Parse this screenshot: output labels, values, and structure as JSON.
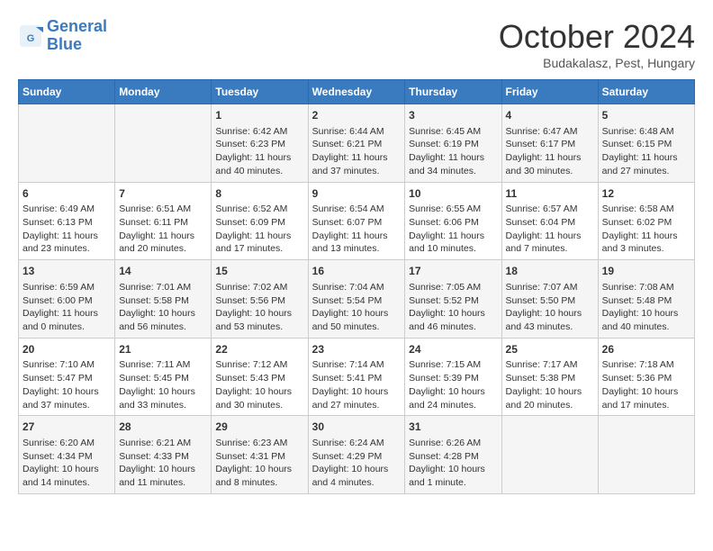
{
  "logo": {
    "line1": "General",
    "line2": "Blue"
  },
  "title": "October 2024",
  "location": "Budakalasz, Pest, Hungary",
  "days_of_week": [
    "Sunday",
    "Monday",
    "Tuesday",
    "Wednesday",
    "Thursday",
    "Friday",
    "Saturday"
  ],
  "weeks": [
    [
      {
        "day": "",
        "info": ""
      },
      {
        "day": "",
        "info": ""
      },
      {
        "day": "1",
        "info": "Sunrise: 6:42 AM\nSunset: 6:23 PM\nDaylight: 11 hours and 40 minutes."
      },
      {
        "day": "2",
        "info": "Sunrise: 6:44 AM\nSunset: 6:21 PM\nDaylight: 11 hours and 37 minutes."
      },
      {
        "day": "3",
        "info": "Sunrise: 6:45 AM\nSunset: 6:19 PM\nDaylight: 11 hours and 34 minutes."
      },
      {
        "day": "4",
        "info": "Sunrise: 6:47 AM\nSunset: 6:17 PM\nDaylight: 11 hours and 30 minutes."
      },
      {
        "day": "5",
        "info": "Sunrise: 6:48 AM\nSunset: 6:15 PM\nDaylight: 11 hours and 27 minutes."
      }
    ],
    [
      {
        "day": "6",
        "info": "Sunrise: 6:49 AM\nSunset: 6:13 PM\nDaylight: 11 hours and 23 minutes."
      },
      {
        "day": "7",
        "info": "Sunrise: 6:51 AM\nSunset: 6:11 PM\nDaylight: 11 hours and 20 minutes."
      },
      {
        "day": "8",
        "info": "Sunrise: 6:52 AM\nSunset: 6:09 PM\nDaylight: 11 hours and 17 minutes."
      },
      {
        "day": "9",
        "info": "Sunrise: 6:54 AM\nSunset: 6:07 PM\nDaylight: 11 hours and 13 minutes."
      },
      {
        "day": "10",
        "info": "Sunrise: 6:55 AM\nSunset: 6:06 PM\nDaylight: 11 hours and 10 minutes."
      },
      {
        "day": "11",
        "info": "Sunrise: 6:57 AM\nSunset: 6:04 PM\nDaylight: 11 hours and 7 minutes."
      },
      {
        "day": "12",
        "info": "Sunrise: 6:58 AM\nSunset: 6:02 PM\nDaylight: 11 hours and 3 minutes."
      }
    ],
    [
      {
        "day": "13",
        "info": "Sunrise: 6:59 AM\nSunset: 6:00 PM\nDaylight: 11 hours and 0 minutes."
      },
      {
        "day": "14",
        "info": "Sunrise: 7:01 AM\nSunset: 5:58 PM\nDaylight: 10 hours and 56 minutes."
      },
      {
        "day": "15",
        "info": "Sunrise: 7:02 AM\nSunset: 5:56 PM\nDaylight: 10 hours and 53 minutes."
      },
      {
        "day": "16",
        "info": "Sunrise: 7:04 AM\nSunset: 5:54 PM\nDaylight: 10 hours and 50 minutes."
      },
      {
        "day": "17",
        "info": "Sunrise: 7:05 AM\nSunset: 5:52 PM\nDaylight: 10 hours and 46 minutes."
      },
      {
        "day": "18",
        "info": "Sunrise: 7:07 AM\nSunset: 5:50 PM\nDaylight: 10 hours and 43 minutes."
      },
      {
        "day": "19",
        "info": "Sunrise: 7:08 AM\nSunset: 5:48 PM\nDaylight: 10 hours and 40 minutes."
      }
    ],
    [
      {
        "day": "20",
        "info": "Sunrise: 7:10 AM\nSunset: 5:47 PM\nDaylight: 10 hours and 37 minutes."
      },
      {
        "day": "21",
        "info": "Sunrise: 7:11 AM\nSunset: 5:45 PM\nDaylight: 10 hours and 33 minutes."
      },
      {
        "day": "22",
        "info": "Sunrise: 7:12 AM\nSunset: 5:43 PM\nDaylight: 10 hours and 30 minutes."
      },
      {
        "day": "23",
        "info": "Sunrise: 7:14 AM\nSunset: 5:41 PM\nDaylight: 10 hours and 27 minutes."
      },
      {
        "day": "24",
        "info": "Sunrise: 7:15 AM\nSunset: 5:39 PM\nDaylight: 10 hours and 24 minutes."
      },
      {
        "day": "25",
        "info": "Sunrise: 7:17 AM\nSunset: 5:38 PM\nDaylight: 10 hours and 20 minutes."
      },
      {
        "day": "26",
        "info": "Sunrise: 7:18 AM\nSunset: 5:36 PM\nDaylight: 10 hours and 17 minutes."
      }
    ],
    [
      {
        "day": "27",
        "info": "Sunrise: 6:20 AM\nSunset: 4:34 PM\nDaylight: 10 hours and 14 minutes."
      },
      {
        "day": "28",
        "info": "Sunrise: 6:21 AM\nSunset: 4:33 PM\nDaylight: 10 hours and 11 minutes."
      },
      {
        "day": "29",
        "info": "Sunrise: 6:23 AM\nSunset: 4:31 PM\nDaylight: 10 hours and 8 minutes."
      },
      {
        "day": "30",
        "info": "Sunrise: 6:24 AM\nSunset: 4:29 PM\nDaylight: 10 hours and 4 minutes."
      },
      {
        "day": "31",
        "info": "Sunrise: 6:26 AM\nSunset: 4:28 PM\nDaylight: 10 hours and 1 minute."
      },
      {
        "day": "",
        "info": ""
      },
      {
        "day": "",
        "info": ""
      }
    ]
  ]
}
